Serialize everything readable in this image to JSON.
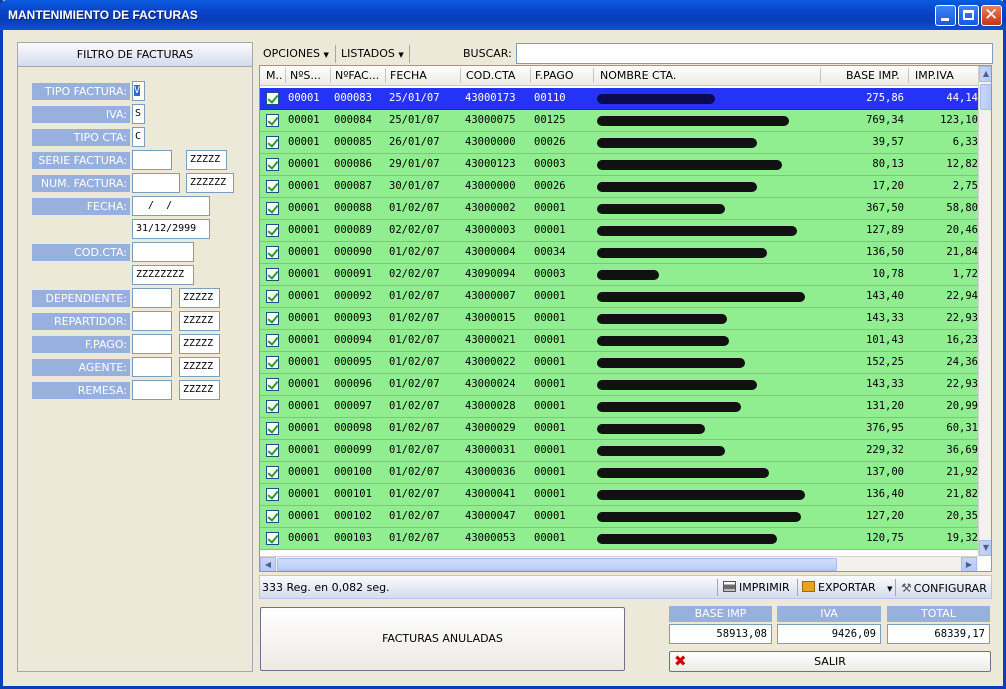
{
  "window": {
    "title": "MANTENIMIENTO DE FACTURAS"
  },
  "filter": {
    "header": "FILTRO DE FACTURAS",
    "fields": {
      "tipo_factura": {
        "label": "TIPO FACTURA:",
        "value": "V"
      },
      "iva": {
        "label": "IVA:",
        "value": "S"
      },
      "tipo_cta": {
        "label": "TIPO CTA:",
        "value": "C"
      },
      "serie_factura": {
        "label": "SERIE FACTURA:",
        "from": "",
        "to": "ZZZZZ"
      },
      "num_factura": {
        "label": "NUM. FACTURA:",
        "from": "",
        "to": "ZZZZZZ"
      },
      "fecha": {
        "label": "FECHA:",
        "from": "  /  /",
        "to": "31/12/2999"
      },
      "cod_cta": {
        "label": "COD.CTA:",
        "from": "",
        "to": "ZZZZZZZZ"
      },
      "dependiente": {
        "label": "DEPENDIENTE:",
        "from": "",
        "to": "ZZZZZ"
      },
      "repartidor": {
        "label": "REPARTIDOR:",
        "from": "",
        "to": "ZZZZZ"
      },
      "fpago": {
        "label": "F.PAGO:",
        "from": "",
        "to": "ZZZZZ"
      },
      "agente": {
        "label": "AGENTE:",
        "from": "",
        "to": "ZZZZZ"
      },
      "remesa": {
        "label": "REMESA:",
        "from": "",
        "to": "ZZZZZ"
      }
    }
  },
  "toolbar": {
    "opciones": "OPCIONES",
    "listados": "LISTADOS",
    "buscar": "BUSCAR:",
    "search_value": ""
  },
  "grid": {
    "columns": [
      "M..",
      "NºS...",
      "NºFAC...",
      "FECHA",
      "COD.CTA",
      "F.PAGO",
      "NOMBRE CTA.",
      "BASE IMP.",
      "IMP.IVA"
    ],
    "rows": [
      {
        "serie": "00001",
        "fac": "000083",
        "fecha": "25/01/07",
        "cta": "43000173",
        "fpago": "00110",
        "base": "275,86",
        "iva": "44,14"
      },
      {
        "serie": "00001",
        "fac": "000084",
        "fecha": "25/01/07",
        "cta": "43000075",
        "fpago": "00125",
        "base": "769,34",
        "iva": "123,10"
      },
      {
        "serie": "00001",
        "fac": "000085",
        "fecha": "26/01/07",
        "cta": "43000000",
        "fpago": "00026",
        "base": "39,57",
        "iva": "6,33"
      },
      {
        "serie": "00001",
        "fac": "000086",
        "fecha": "29/01/07",
        "cta": "43000123",
        "fpago": "00003",
        "base": "80,13",
        "iva": "12,82"
      },
      {
        "serie": "00001",
        "fac": "000087",
        "fecha": "30/01/07",
        "cta": "43000000",
        "fpago": "00026",
        "base": "17,20",
        "iva": "2,75"
      },
      {
        "serie": "00001",
        "fac": "000088",
        "fecha": "01/02/07",
        "cta": "43000002",
        "fpago": "00001",
        "base": "367,50",
        "iva": "58,80"
      },
      {
        "serie": "00001",
        "fac": "000089",
        "fecha": "02/02/07",
        "cta": "43000003",
        "fpago": "00001",
        "base": "127,89",
        "iva": "20,46"
      },
      {
        "serie": "00001",
        "fac": "000090",
        "fecha": "01/02/07",
        "cta": "43000004",
        "fpago": "00034",
        "base": "136,50",
        "iva": "21,84"
      },
      {
        "serie": "00001",
        "fac": "000091",
        "fecha": "02/02/07",
        "cta": "43090094",
        "fpago": "00003",
        "base": "10,78",
        "iva": "1,72"
      },
      {
        "serie": "00001",
        "fac": "000092",
        "fecha": "01/02/07",
        "cta": "43000007",
        "fpago": "00001",
        "base": "143,40",
        "iva": "22,94"
      },
      {
        "serie": "00001",
        "fac": "000093",
        "fecha": "01/02/07",
        "cta": "43000015",
        "fpago": "00001",
        "base": "143,33",
        "iva": "22,93"
      },
      {
        "serie": "00001",
        "fac": "000094",
        "fecha": "01/02/07",
        "cta": "43000021",
        "fpago": "00001",
        "base": "101,43",
        "iva": "16,23"
      },
      {
        "serie": "00001",
        "fac": "000095",
        "fecha": "01/02/07",
        "cta": "43000022",
        "fpago": "00001",
        "base": "152,25",
        "iva": "24,36"
      },
      {
        "serie": "00001",
        "fac": "000096",
        "fecha": "01/02/07",
        "cta": "43000024",
        "fpago": "00001",
        "base": "143,33",
        "iva": "22,93"
      },
      {
        "serie": "00001",
        "fac": "000097",
        "fecha": "01/02/07",
        "cta": "43000028",
        "fpago": "00001",
        "base": "131,20",
        "iva": "20,99"
      },
      {
        "serie": "00001",
        "fac": "000098",
        "fecha": "01/02/07",
        "cta": "43000029",
        "fpago": "00001",
        "base": "376,95",
        "iva": "60,31"
      },
      {
        "serie": "00001",
        "fac": "000099",
        "fecha": "01/02/07",
        "cta": "43000031",
        "fpago": "00001",
        "base": "229,32",
        "iva": "36,69"
      },
      {
        "serie": "00001",
        "fac": "000100",
        "fecha": "01/02/07",
        "cta": "43000036",
        "fpago": "00001",
        "base": "137,00",
        "iva": "21,92"
      },
      {
        "serie": "00001",
        "fac": "000101",
        "fecha": "01/02/07",
        "cta": "43000041",
        "fpago": "00001",
        "base": "136,40",
        "iva": "21,82"
      },
      {
        "serie": "00001",
        "fac": "000102",
        "fecha": "01/02/07",
        "cta": "43000047",
        "fpago": "00001",
        "base": "127,20",
        "iva": "20,35"
      },
      {
        "serie": "00001",
        "fac": "000103",
        "fecha": "01/02/07",
        "cta": "43000053",
        "fpago": "00001",
        "base": "120,75",
        "iva": "19,32"
      }
    ]
  },
  "status": {
    "records": "333 Reg. en 0,082 seg.",
    "imprimir": "IMPRIMIR",
    "exportar": "EXPORTAR",
    "configurar": "CONFIGURAR"
  },
  "anuladas_label": "FACTURAS ANULADAS",
  "totals": {
    "base_label": "BASE IMP",
    "base_value": "58913,08",
    "iva_label": "IVA",
    "iva_value": "9426,09",
    "total_label": "TOTAL",
    "total_value": "68339,17"
  },
  "salir_label": "SALIR",
  "colors": {
    "row_green": "#90EE90",
    "row_selected": "#2433F5",
    "label_blue": "#97B0DE"
  }
}
